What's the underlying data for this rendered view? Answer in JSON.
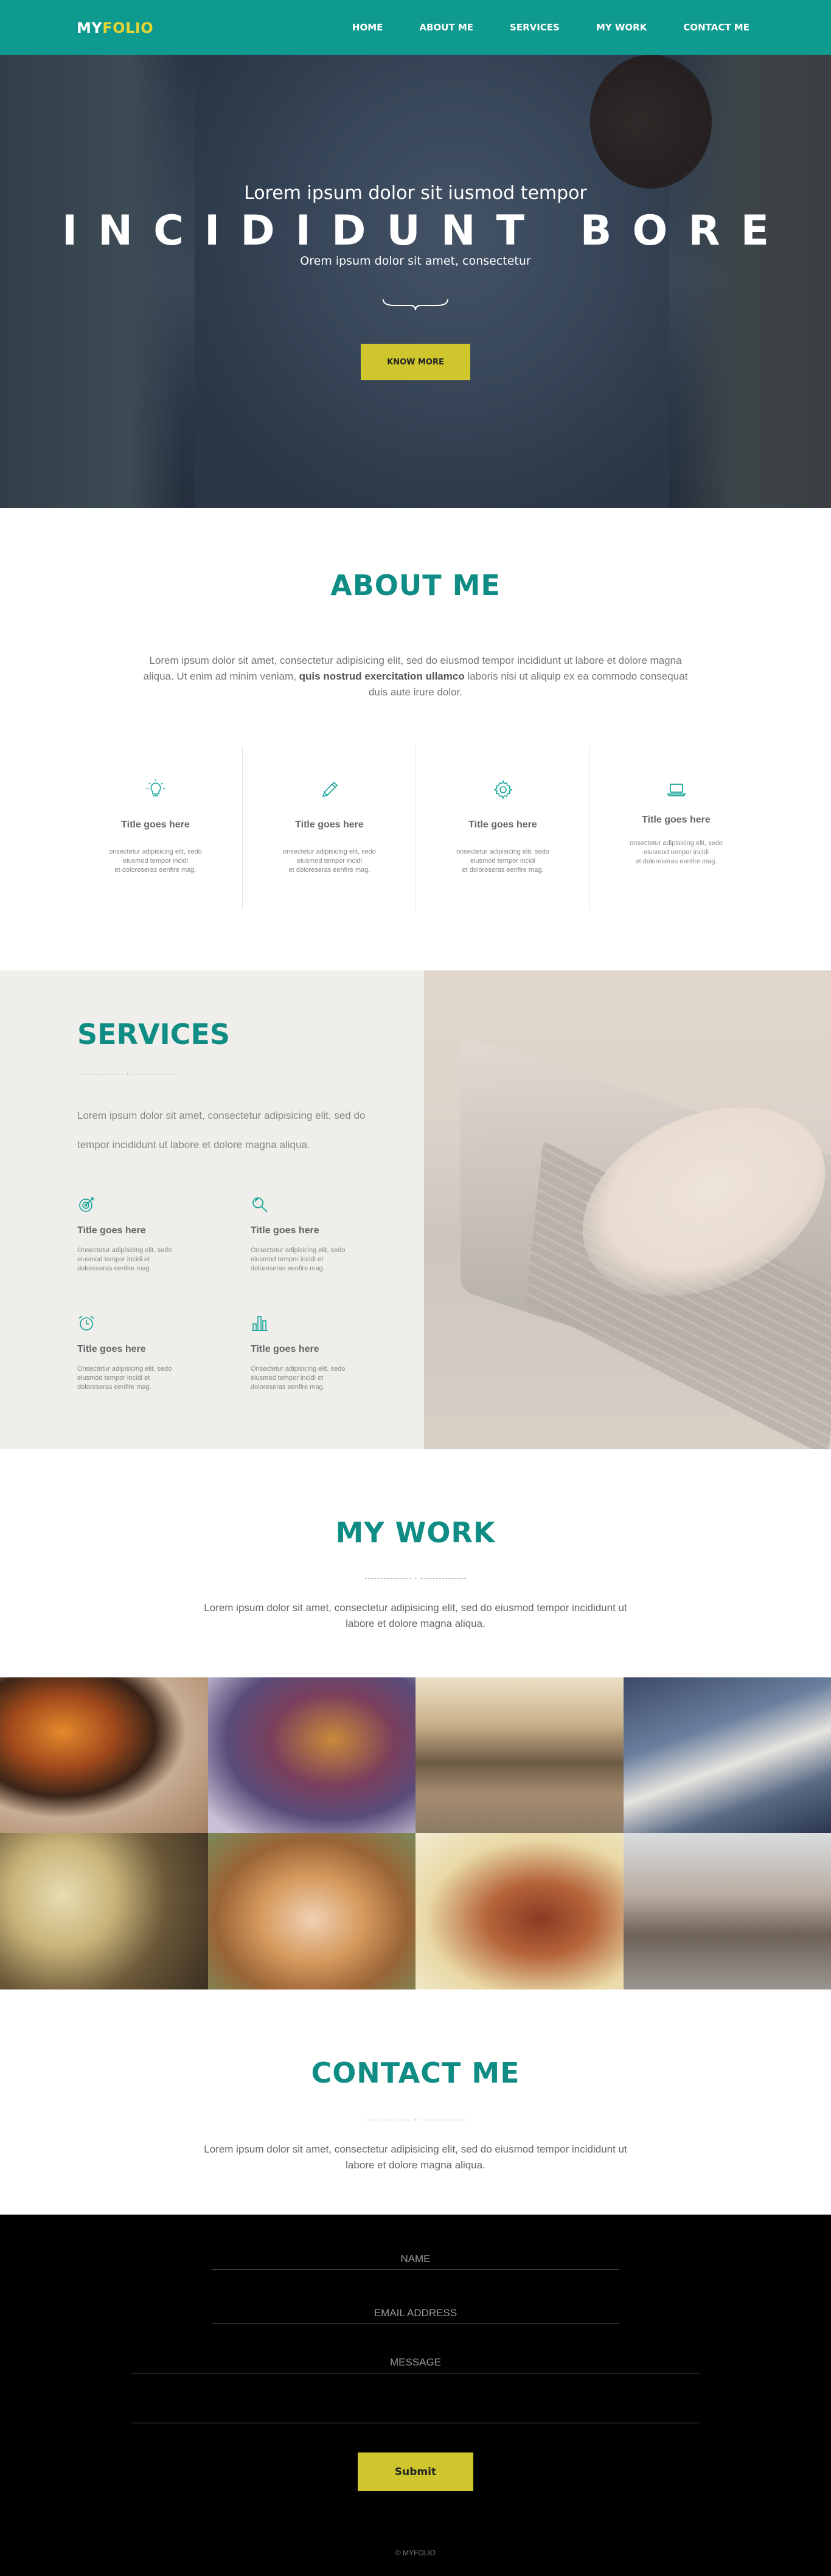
{
  "brand": {
    "part1": "MY",
    "part2": "FOLIO",
    "accent": "#e8d531",
    "primary": "#0f9a90"
  },
  "nav": {
    "items": [
      "HOME",
      "ABOUT ME",
      "SERVICES",
      "MY WORK",
      "CONTACT ME"
    ]
  },
  "hero": {
    "subtitle": "Lorem ipsum dolor sit iusmod tempor",
    "title": "INCIDIDUNT BORE",
    "tagline": "Orem ipsum dolor sit amet, consectetur",
    "button": "KNOW MORE"
  },
  "about": {
    "title": "ABOUT ME",
    "text_before": "Lorem ipsum dolor sit amet, consectetur adipisicing elit, sed do eiusmod tempor incididunt ut labore et dolore magna aliqua. Ut enim ad minim veniam, ",
    "text_bold": "quis nostrud exercitation ullamco",
    "text_after": " laboris nisi ut aliquip ex ea commodo consequat duis aute irure dolor.",
    "features": [
      {
        "icon": "lightbulb-icon",
        "title": "Title goes here",
        "line1": "onsectetur adipisicing elit, sedo",
        "line2": "eiusmod tempor incidi",
        "line3": "et doloreseras eenfire mag."
      },
      {
        "icon": "pencil-icon",
        "title": "Title goes here",
        "line1": "onsectetur adipisicing elit, sedo",
        "line2": "eiusmod tempor incidi",
        "line3": "et doloreseras eenfire mag."
      },
      {
        "icon": "gear-icon",
        "title": "Title goes here",
        "line1": "onsectetur adipisicing elit, sedo",
        "line2": "eiusmod tempor incidi",
        "line3": "et doloreseras eenfire mag."
      },
      {
        "icon": "laptop-icon",
        "title": "Title goes here",
        "line1": "onsectetur adipisicing elit, sedo",
        "line2": "eiusmod tempor incidi",
        "line3": "et doloreseras eenfire mag."
      }
    ]
  },
  "services": {
    "title": "SERVICES",
    "text": "Lorem ipsum dolor sit amet, consectetur adipisicing elit, sed do tempor incididunt ut labore et dolore magna aliqua.",
    "items": [
      {
        "icon": "target-icon",
        "title": "Title goes here",
        "line1": "Onsectetur adipisicing elit, sedo",
        "line2": "eiusmod tempor incidi et",
        "line3": "doloreseras eenfire mag."
      },
      {
        "icon": "magnifier-icon",
        "title": "Title goes here",
        "line1": "Onsectetur adipisicing elit, sedo",
        "line2": "eiusmod tempor incidi et",
        "line3": "doloreseras eenfire mag."
      },
      {
        "icon": "alarm-clock-icon",
        "title": "Title goes here",
        "line1": "Onsectetur adipisicing elit, sedo",
        "line2": "eiusmod tempor incidi et",
        "line3": "doloreseras eenfire mag."
      },
      {
        "icon": "bar-chart-icon",
        "title": "Title goes here",
        "line1": "Onsectetur adipisicing elit, sedo",
        "line2": "eiusmod tempor incidi et",
        "line3": "doloreseras eenfire mag."
      }
    ]
  },
  "work": {
    "title": "MY WORK",
    "text": "Lorem ipsum dolor sit amet, consectetur adipisicing elit, sed do eiusmod tempor incididunt ut labore et dolore magna aliqua.",
    "photos": [
      "sunglasses-photo",
      "autumn-leaf-photo",
      "car-road-photo",
      "swan-photo",
      "banana-chia-photo",
      "dog-photo",
      "hair-sunlight-photo",
      "street-woman-photo"
    ]
  },
  "contact": {
    "title": "CONTACT ME",
    "text": "Lorem ipsum dolor sit amet, consectetur adipisicing elit, sed do eiusmod tempor incididunt ut labore et dolore magna aliqua."
  },
  "form": {
    "name_placeholder": "NAME",
    "email_placeholder": "EMAIL ADDRESS",
    "message_placeholder": "MESSAGE",
    "submit": "Submit"
  },
  "footer": {
    "copyright": "© MYFOLIO"
  }
}
